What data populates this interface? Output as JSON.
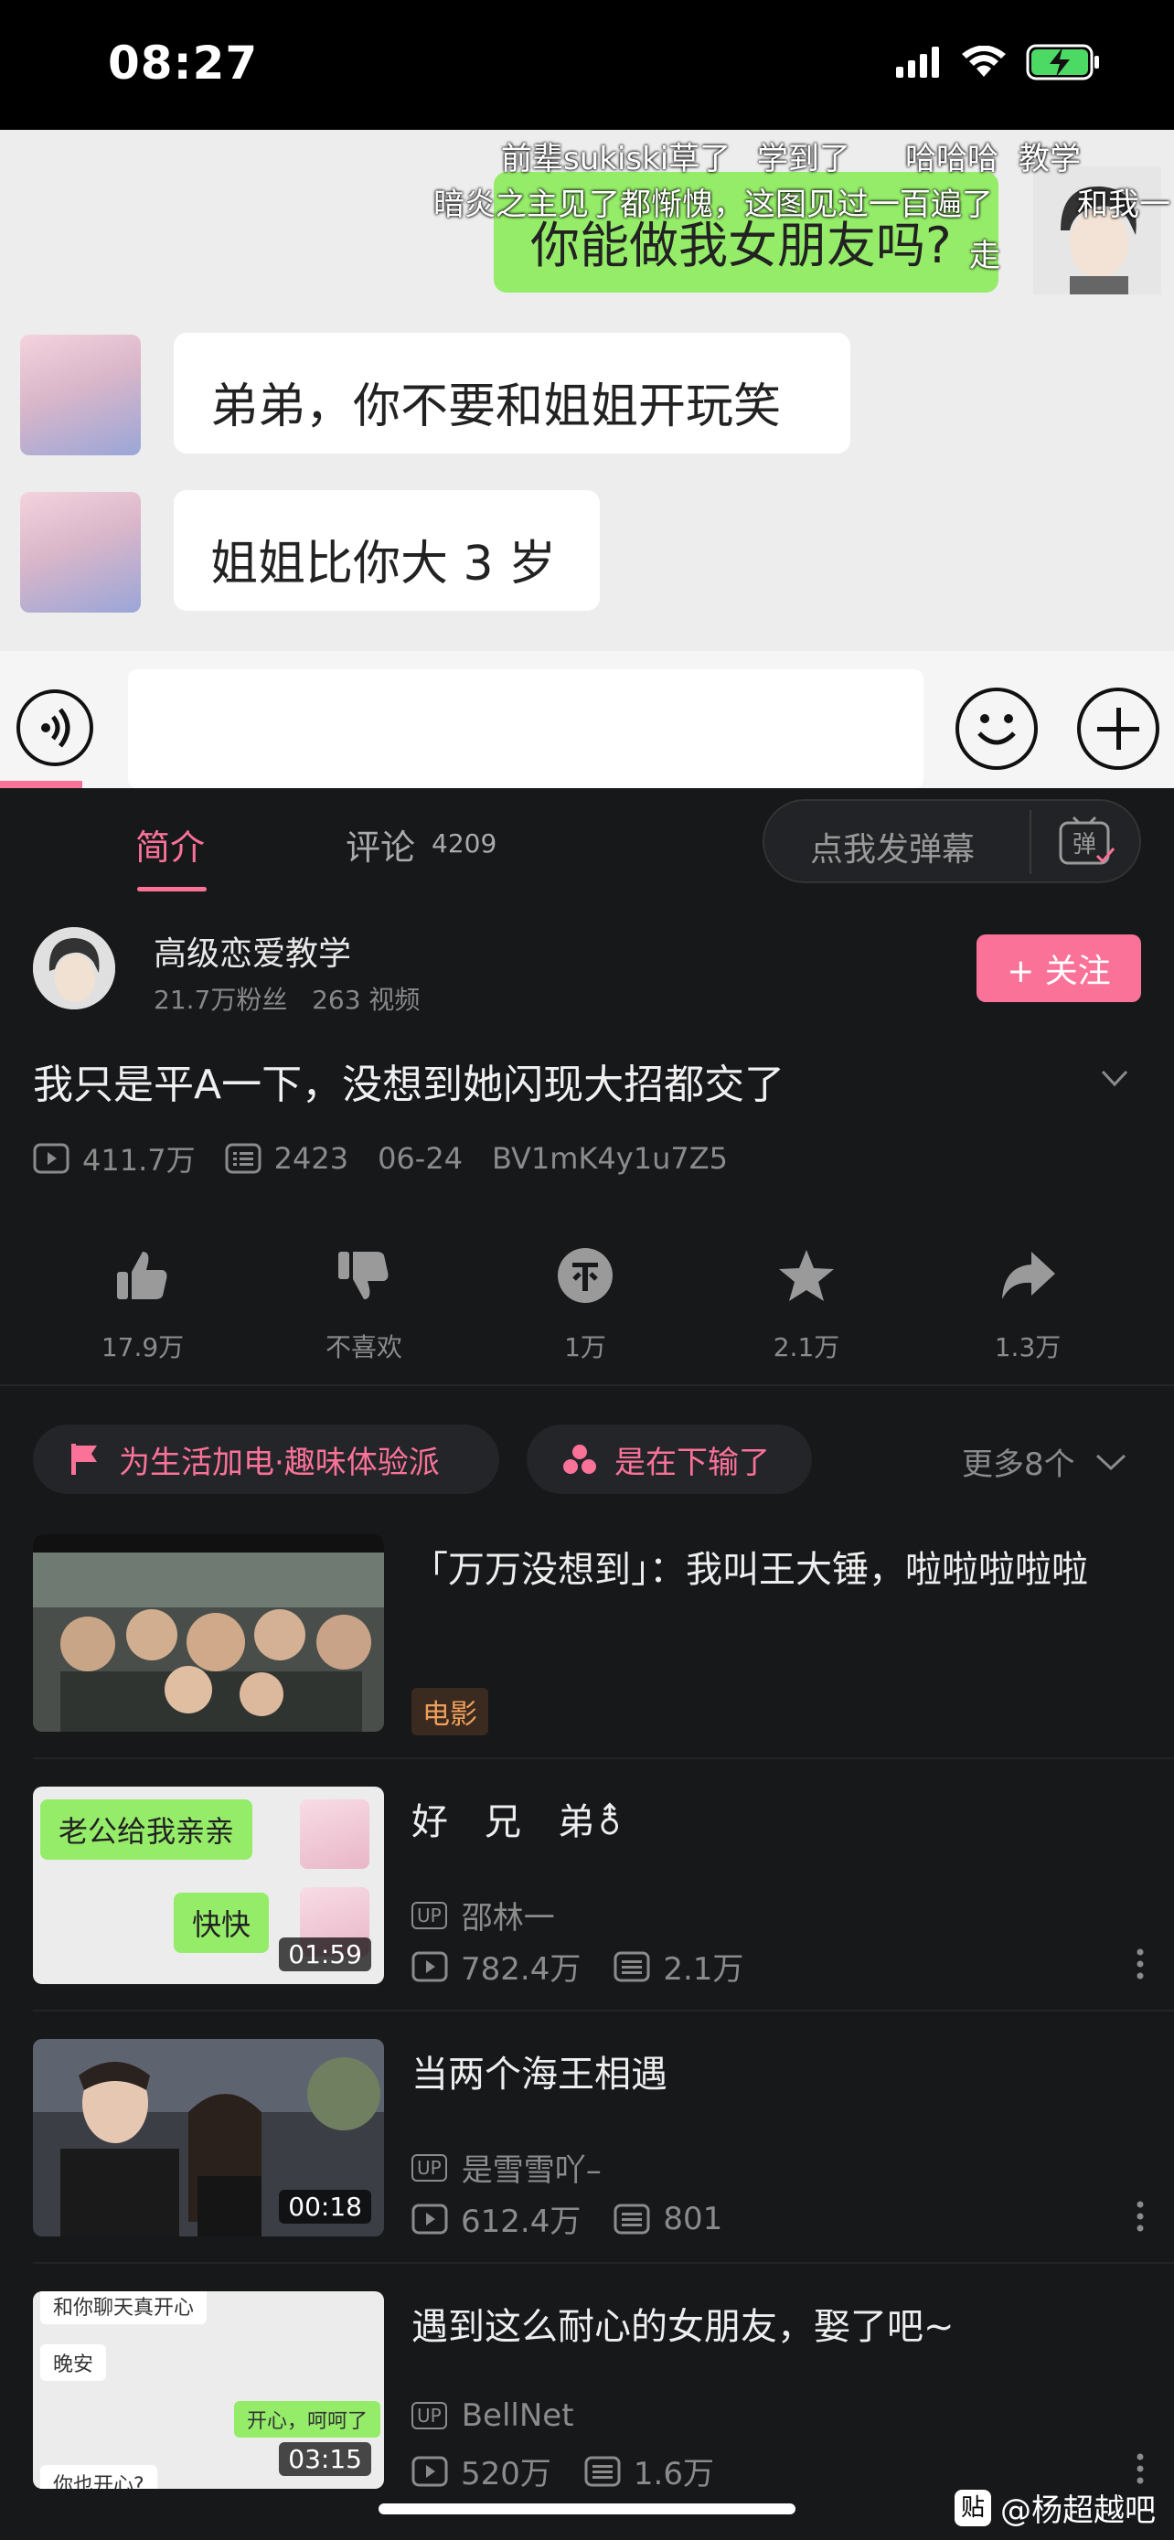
{
  "status": {
    "time": "08:27"
  },
  "video": {
    "chat": {
      "right_message": "你能做我女朋友吗?",
      "left_messages": [
        "弟弟，你不要和姐姐开玩笑",
        "姐姐比你大 3 岁"
      ]
    },
    "danmaku": [
      "前辈sukiski草了",
      "学到了",
      "哈哈哈",
      "教学",
      "暗炎之主见了都惭愧，这图见过一百遍了",
      "和我一",
      "走"
    ]
  },
  "tabs": {
    "intro": "简介",
    "comments": "评论",
    "comments_count": "4209"
  },
  "danmaku_input": {
    "placeholder": "点我发弹幕",
    "switch_label": "弹"
  },
  "uploader": {
    "name": "高级恋爱教学",
    "followers": "21.7万粉丝",
    "videos": "263 视频",
    "follow_label": "+ 关注"
  },
  "video_info": {
    "title": "我只是平A一下，没想到她闪现大招都交了",
    "views": "411.7万",
    "danmaku_count": "2423",
    "date": "06-24",
    "bvid": "BV1mK4y1u7Z5"
  },
  "actions": [
    {
      "icon": "thumb-up-icon",
      "label": "17.9万"
    },
    {
      "icon": "thumb-down-icon",
      "label": "不喜欢"
    },
    {
      "icon": "coin-icon",
      "label": "1万"
    },
    {
      "icon": "star-icon",
      "label": "2.1万"
    },
    {
      "icon": "share-icon",
      "label": "1.3万"
    }
  ],
  "tags": [
    {
      "icon": "flag-icon",
      "label": "为生活加电·趣味体验派"
    },
    {
      "icon": "dots-icon",
      "label": "是在下输了"
    }
  ],
  "more_tags": "更多8个",
  "recommendations": [
    {
      "title": "「万万没想到」：我叫王大锤，啦啦啦啦啦",
      "badge": "电影"
    },
    {
      "title": "好　兄　弟⚨",
      "uploader": "邵林一",
      "views": "782.4万",
      "danmaku": "2.1万",
      "duration": "01:59",
      "thumb_lines": [
        "老公给我亲亲",
        "快快"
      ]
    },
    {
      "title": "当两个海王相遇",
      "uploader": "是雪雪吖–",
      "views": "612.4万",
      "danmaku": "801",
      "duration": "00:18"
    },
    {
      "title": "遇到这么耐心的女朋友，娶了吧~",
      "uploader": "BellNet",
      "views": "520万",
      "danmaku": "1.6万",
      "duration": "03:15",
      "thumb_lines": [
        "和你聊天真开心",
        "晚安",
        "开心，呵呵了",
        "你也开心?"
      ]
    }
  ],
  "up_badge": "UP",
  "watermark": "@杨超越吧",
  "colors": {
    "accent": "#fb7299",
    "background": "#17181a",
    "chat_green": "#95ec69"
  }
}
